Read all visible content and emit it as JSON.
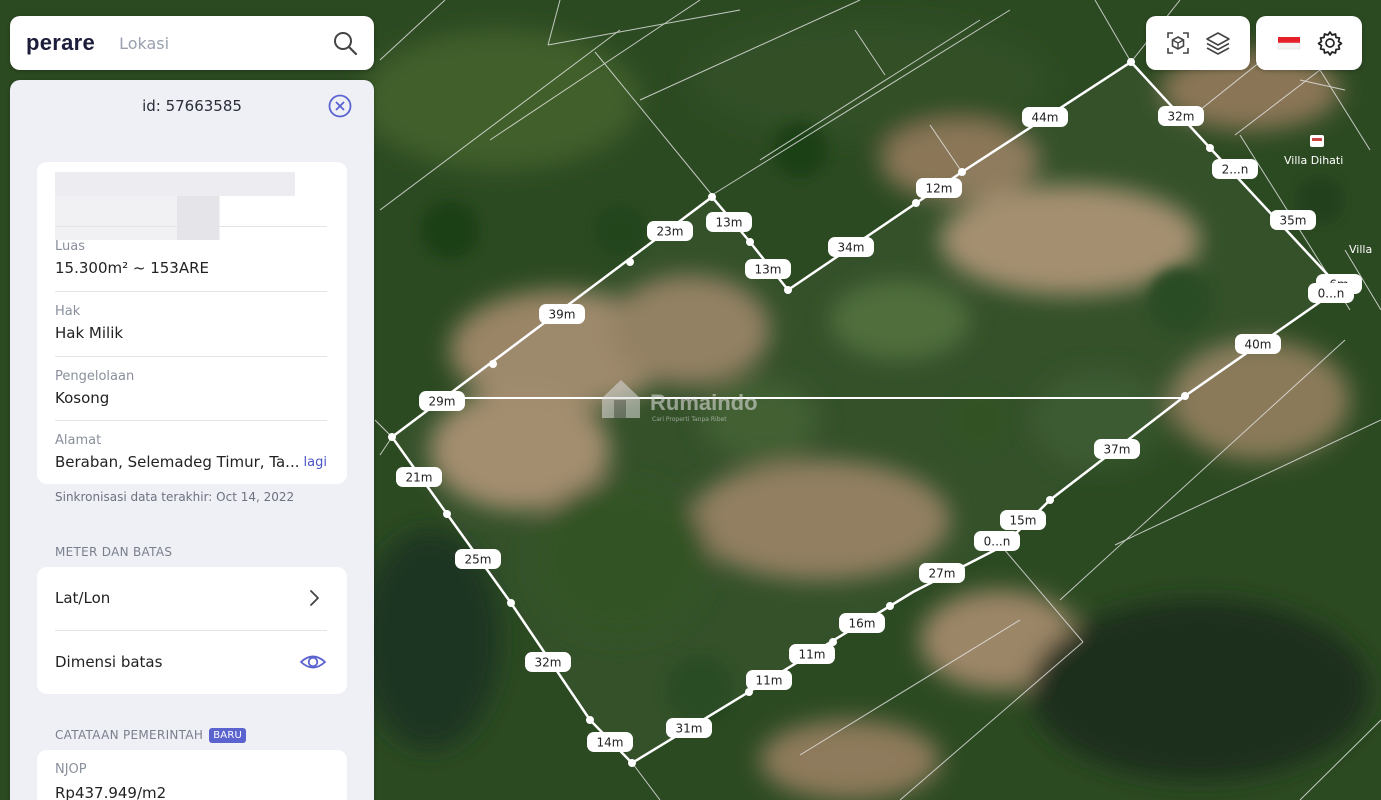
{
  "search": {
    "logo": "perare",
    "placeholder": "Lokasi"
  },
  "panel": {
    "id_text": "id: 57663585",
    "fields": [
      {
        "label": "Luas",
        "value": "15.300m² ~ 153ARE"
      },
      {
        "label": "Hak",
        "value": "Hak Milik"
      },
      {
        "label": "Pengelolaan",
        "value": "Kosong"
      },
      {
        "label": "Alamat",
        "value": "Beraban, Selemadeg Timur, Ta...",
        "more": "lagi"
      }
    ],
    "sync_text": "Sinkronisasi data terakhir: Oct 14, 2022",
    "meter_section_title": "METER DAN BATAS",
    "meter_rows": [
      {
        "label": "Lat/Lon",
        "icon": "chevron-right-icon"
      },
      {
        "label": "Dimensi batas",
        "icon": "eye-icon"
      }
    ],
    "gov_section_title": "CATATAAN PEMERINTAH",
    "gov_badge": "BARU",
    "njop": {
      "label": "NJOP",
      "value": "Rp437.949/m2"
    }
  },
  "map": {
    "dimension_labels": [
      "32m",
      "44m",
      "2...n",
      "35m",
      "12m",
      "23m",
      "13m",
      "34m",
      "13m",
      "6m",
      "0...n",
      "39m",
      "40m",
      "29m",
      "37m",
      "21m",
      "15m",
      "0...n",
      "27m",
      "25m",
      "16m",
      "11m",
      "32m",
      "11m",
      "31m",
      "14m"
    ],
    "poi": {
      "name": "Villa Dihati",
      "partial": "Villa"
    },
    "watermark": {
      "brand": "Rumaindo",
      "tagline": "Cari Properti Tanpa Ribet"
    }
  },
  "toolbar": {
    "left_icons": [
      "ar-scan-icon",
      "layers-icon"
    ],
    "right_icons": [
      "indonesia-flag-icon",
      "gear-icon"
    ]
  },
  "colors": {
    "brand_dark": "#1b1d3a",
    "accent": "#5b63cf",
    "panel_bg": "#eef0f5",
    "flag_red": "#e5202b"
  }
}
